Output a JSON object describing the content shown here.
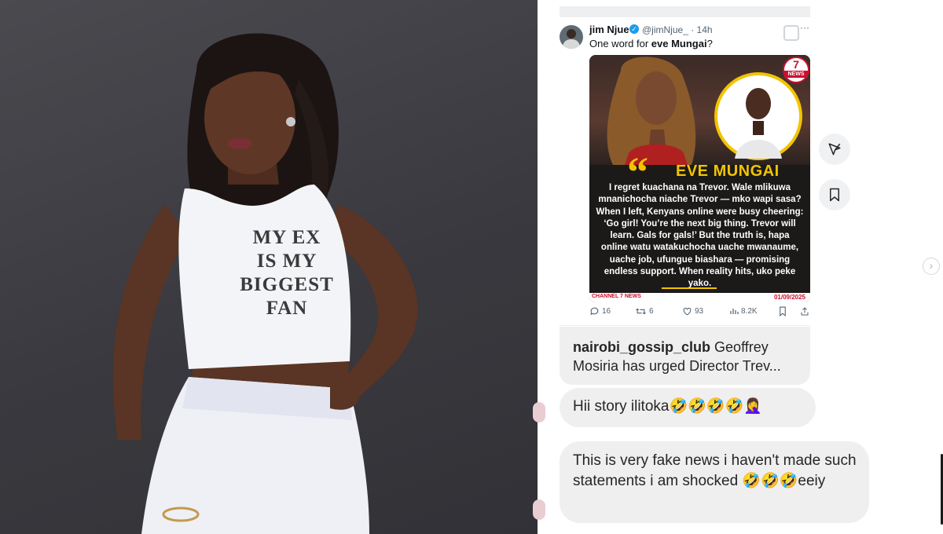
{
  "photo": {
    "shirt_text": "MY EX\nIS MY\nBIGGEST\nFAN"
  },
  "tweet": {
    "author_name": "jim Njue",
    "handle_time": "@jimNjue_ · 14h",
    "more_label": "···",
    "text_prefix": "One word for ",
    "text_bold": "eve Mungai",
    "text_suffix": "?",
    "card": {
      "logo_number": "7",
      "logo_label": "NEWS",
      "quote_mark": "“",
      "headline": "EVE MUNGAI",
      "body": "I regret kuachana na Trevor. Wale mlikuwa mnanichocha niache Trevor — mko wapi sasa? When I left, Kenyans online were busy cheering: ‘Go girl! You’re the next big thing. Trevor will learn. Gals for gals!’ But the truth is, hapa online watu watakuchocha uache mwanaume, uache job, ufungue biashara — promising endless support. When reality hits, uko peke yako.",
      "footer_left": "CHANNEL 7 NEWS",
      "footer_right": "01/09/2025"
    },
    "stats": {
      "replies": "16",
      "retweets": "6",
      "likes": "93",
      "views": "8.2K"
    }
  },
  "comments": {
    "gossip_user": "nairobi_gossip_club",
    "gossip_text": " Geoffrey Mosiria has urged Director Trev...",
    "reply1": "Hii story ilitoka🤣🤣🤣🤣🤦‍♀️",
    "reply2": "This is very fake news i haven't made such statements i am shocked 🤣🤣🤣eeiy"
  },
  "colors": {
    "accent_yellow": "#f2c400",
    "brand_red": "#c8102e",
    "bubble_bg": "#efefef",
    "verified_blue": "#1d9bf0"
  },
  "icons": [
    "send-icon",
    "bookmark-icon",
    "chevron-right-icon",
    "reply-icon",
    "retweet-icon",
    "like-icon",
    "views-icon",
    "tweet-bookmark-icon",
    "share-icon",
    "verified-icon"
  ]
}
